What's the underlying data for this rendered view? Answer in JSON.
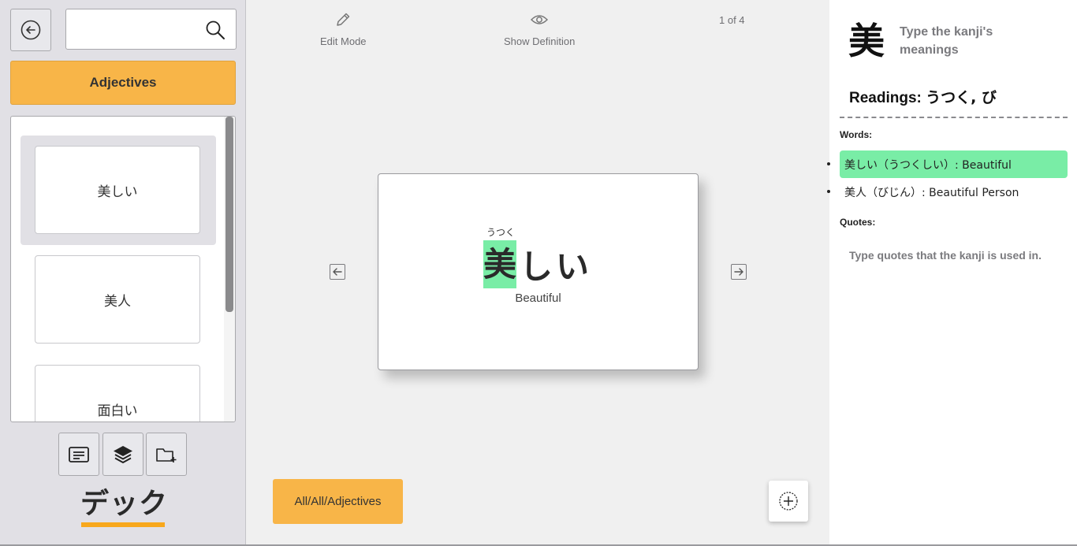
{
  "sidebar": {
    "search": {
      "value": "",
      "placeholder": ""
    },
    "deck_button": "Adjectives",
    "cards": [
      {
        "label": "美しい",
        "selected": true
      },
      {
        "label": "美人",
        "selected": false
      },
      {
        "label": "面白い",
        "selected": false
      }
    ],
    "tools": [
      "card-list-icon",
      "layers-icon",
      "new-folder-icon"
    ],
    "deck_label": "デック"
  },
  "toolbar": {
    "edit_mode": "Edit Mode",
    "show_definition": "Show Definition",
    "page_counter": "1 of 4"
  },
  "card": {
    "furigana": "うつく",
    "kanji": "美",
    "kana": "しい",
    "meaning": "Beautiful"
  },
  "footer": {
    "path": "All/All/Adjectives"
  },
  "detail": {
    "kanji": "美",
    "meanings_placeholder": "Type the kanji's meanings",
    "readings_label": "Readings:",
    "readings_value": "うつく, び",
    "words_label": "Words:",
    "words": [
      {
        "text": "美しい（うつくしい）: Beautiful",
        "highlighted": true
      },
      {
        "text": "美人（びじん）: Beautiful Person",
        "highlighted": false
      }
    ],
    "quotes_label": "Quotes:",
    "quotes_placeholder": "Type quotes that the kanji is used in."
  },
  "colors": {
    "accent_orange": "#f8b548",
    "highlight_green": "#79eda6",
    "sidebar_bg": "#e1e0e5"
  }
}
